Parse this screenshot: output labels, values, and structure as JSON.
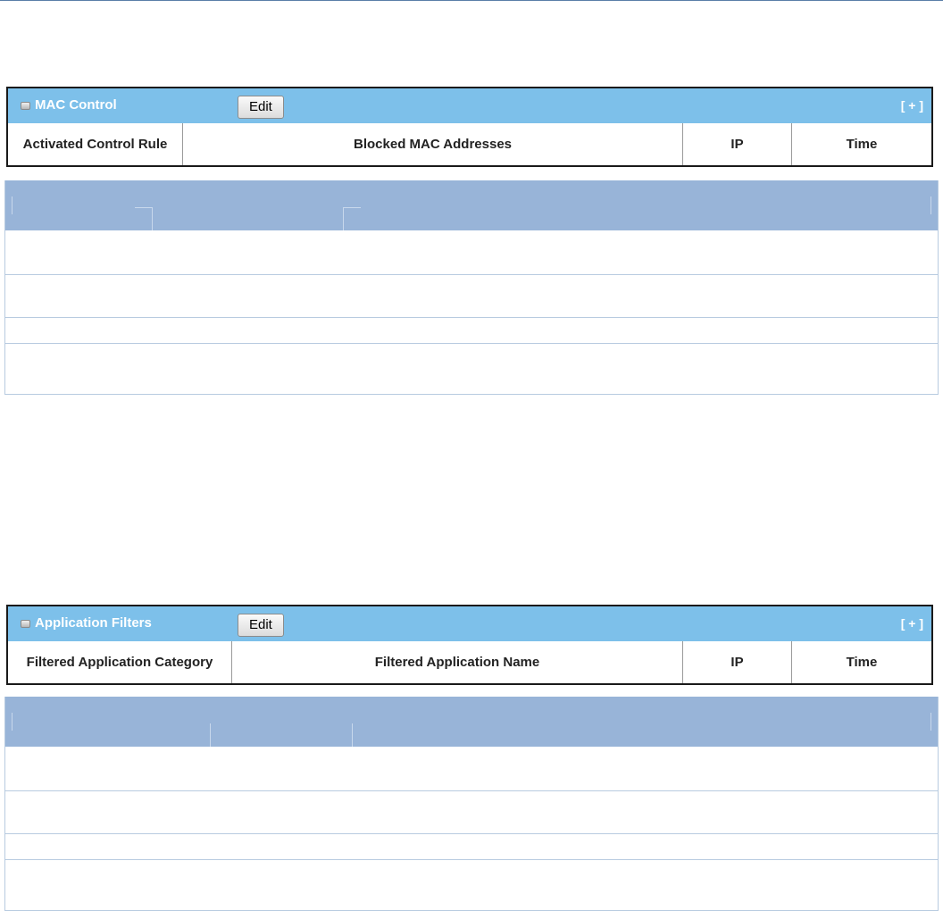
{
  "mac_control": {
    "title": "MAC Control",
    "edit_label": "Edit",
    "expand_label": "[ + ]",
    "columns": [
      "Activated Control Rule",
      "Blocked MAC Addresses",
      "IP",
      "Time"
    ]
  },
  "application_filters": {
    "title": "Application Filters",
    "edit_label": "Edit",
    "expand_label": "[ + ]",
    "columns": [
      "Filtered Application Category",
      "Filtered Application Name",
      "IP",
      "Time"
    ]
  },
  "colors": {
    "panel_header": "#7dc0ea",
    "table_header": "#98b4d8",
    "row_border": "#b8cbe0"
  }
}
